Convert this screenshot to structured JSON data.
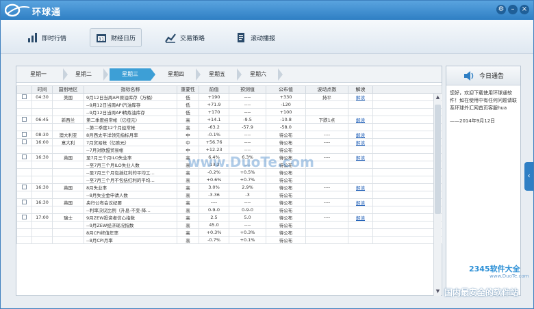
{
  "app": {
    "title": "环球通"
  },
  "toolbar": {
    "items": [
      {
        "label": "即时行情"
      },
      {
        "label": "财经日历"
      },
      {
        "label": "交易策略"
      },
      {
        "label": "滚动播报"
      }
    ]
  },
  "tabs": [
    "星期一",
    "星期二",
    "星期三",
    "星期四",
    "星期五",
    "星期六"
  ],
  "active_tab": "星期三",
  "table": {
    "columns": [
      "时间",
      "国别地区",
      "指标名称",
      "重要性",
      "前值",
      "预测值",
      "公布值",
      "波动点数",
      "解读"
    ],
    "rows": [
      {
        "time": "04:30",
        "country": "美国",
        "name": "9月12日当周API原油库存（万桶）",
        "imp": "低",
        "prev": "+190",
        "fc": "----",
        "act": "+330",
        "pts": "持平",
        "read": "解读"
      },
      {
        "time": "",
        "country": "",
        "name": "--9月12日当周API汽油库存",
        "imp": "低",
        "prev": "+71.9",
        "fc": "----",
        "act": "-120",
        "pts": "",
        "read": ""
      },
      {
        "time": "",
        "country": "",
        "name": "--9月12日当周API精炼油库存",
        "imp": "低",
        "prev": "+170",
        "fc": "----",
        "act": "+100",
        "pts": "",
        "read": ""
      },
      {
        "time": "06:45",
        "country": "新西兰",
        "name": "第二季度经常帐（亿纽元）",
        "imp": "高",
        "prev": "+14.1",
        "fc": "-9.5",
        "act": "-10.8",
        "pts": "下跌1点",
        "read": "解读"
      },
      {
        "time": "",
        "country": "",
        "name": "--第二季度12个月经常帐",
        "imp": "高",
        "prev": "-63.2",
        "fc": "-57.9",
        "act": "-58.0",
        "pts": "",
        "read": ""
      },
      {
        "time": "08:30",
        "country": "澳大利亚",
        "name": "8月西太平洋领先指标月率",
        "imp": "中",
        "prev": "-0.1%",
        "fc": "----",
        "act": "待公布",
        "pts": "----",
        "read": "解读"
      },
      {
        "time": "16:00",
        "country": "意大利",
        "name": "7月贸易帐（亿欧元）",
        "imp": "中",
        "prev": "+56.76",
        "fc": "----",
        "act": "待公布",
        "pts": "----",
        "read": "解读"
      },
      {
        "time": "",
        "country": "",
        "name": "--7月对欧盟贸易帐",
        "imp": "中",
        "prev": "+12.23",
        "fc": "----",
        "act": "待公布",
        "pts": "",
        "read": ""
      },
      {
        "time": "16:30",
        "country": "英国",
        "name": "至7月三个月ILO失业率",
        "imp": "高",
        "prev": "6.4%",
        "fc": "6.3%",
        "act": "待公布",
        "pts": "----",
        "read": "解读"
      },
      {
        "time": "",
        "country": "",
        "name": "--至7月三个月ILO失业人数",
        "imp": "高",
        "prev": "-13.2",
        "fc": "----",
        "act": "待公布",
        "pts": "",
        "read": ""
      },
      {
        "time": "",
        "country": "",
        "name": "--至7月三个月包括红利的平均工…",
        "imp": "高",
        "prev": "-0.2%",
        "fc": "+0.5%",
        "act": "待公布",
        "pts": "",
        "read": ""
      },
      {
        "time": "",
        "country": "",
        "name": "--至7月三个月不包括红利的平均…",
        "imp": "高",
        "prev": "+0.6%",
        "fc": "+0.7%",
        "act": "待公布",
        "pts": "",
        "read": ""
      },
      {
        "time": "16:30",
        "country": "英国",
        "name": "8月失业率",
        "imp": "高",
        "prev": "3.0%",
        "fc": "2.9%",
        "act": "待公布",
        "pts": "----",
        "read": "解读"
      },
      {
        "time": "",
        "country": "",
        "name": "--8月失业金申请人数",
        "imp": "高",
        "prev": "-3.36",
        "fc": "-3",
        "act": "待公布",
        "pts": "",
        "read": ""
      },
      {
        "time": "16:30",
        "country": "英国",
        "name": "央行公布会议纪要",
        "imp": "高",
        "prev": "----",
        "fc": "----",
        "act": "待公布",
        "pts": "----",
        "read": "解读"
      },
      {
        "time": "",
        "country": "",
        "name": "--利率决议比例（升息-不变-降…",
        "imp": "高",
        "prev": "0-9-0",
        "fc": "0-9-0",
        "act": "待公布",
        "pts": "",
        "read": ""
      },
      {
        "time": "17:00",
        "country": "瑞士",
        "name": "9月ZEW投资者信心指数",
        "imp": "高",
        "prev": "2.5",
        "fc": "5.0",
        "act": "待公布",
        "pts": "----",
        "read": "解读"
      },
      {
        "time": "",
        "country": "",
        "name": "--9月ZEW经济现况指数",
        "imp": "高",
        "prev": "45.0",
        "fc": "----",
        "act": "待公布",
        "pts": "",
        "read": ""
      },
      {
        "time": "",
        "country": "",
        "name": "8月CPI终值年率",
        "imp": "高",
        "prev": "+0.3%",
        "fc": "+0.3%",
        "act": "待公布",
        "pts": "",
        "read": ""
      },
      {
        "time": "",
        "country": "",
        "name": "--8月CPI月率",
        "imp": "高",
        "prev": "-0.7%",
        "fc": "+0.1%",
        "act": "待公布",
        "pts": "",
        "read": ""
      }
    ]
  },
  "sidebar": {
    "title": "今日通告",
    "text": "您好，欢迎下载使用环球通软件！如在使用中有任何问题请联系环球外汇网首页客服hua",
    "date": "——2014年9月12日"
  },
  "watermarks": {
    "center": "www.DuoTe.com",
    "brand": "2345软件大全",
    "brand_url": "www.DuoTe.com",
    "slogan": "国内最安全的软件站"
  }
}
